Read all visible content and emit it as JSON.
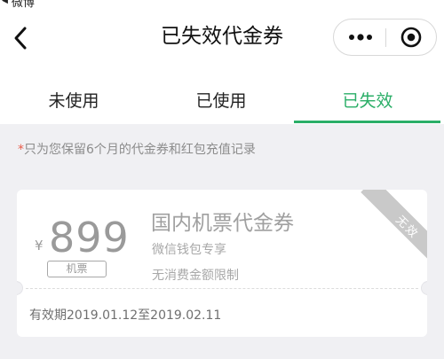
{
  "status_bar": {
    "app_label": "微博"
  },
  "header": {
    "title": "已失效代金券"
  },
  "tabs": [
    {
      "label": "未使用",
      "active": false
    },
    {
      "label": "已使用",
      "active": false
    },
    {
      "label": "已失效",
      "active": true
    }
  ],
  "notice": {
    "star": "*",
    "text": "只为您保留6个月的代金券和红包充值记录"
  },
  "coupon": {
    "currency": "¥",
    "amount": "899",
    "type_tag": "机票",
    "title": "国内机票代金券",
    "subtitle": "微信钱包专享",
    "limit": "无消费金额限制",
    "validity": "有效期2019.01.12至2019.02.11",
    "status_ribbon": "无效"
  },
  "colors": {
    "accent": "#2aae67",
    "background": "#f0f0f3",
    "muted_text": "#9a9a9a",
    "required_star": "#e85c4a"
  },
  "icons": {
    "back": "chevron-left-icon",
    "more": "more-dots-icon",
    "close_mini": "target-circle-icon"
  }
}
